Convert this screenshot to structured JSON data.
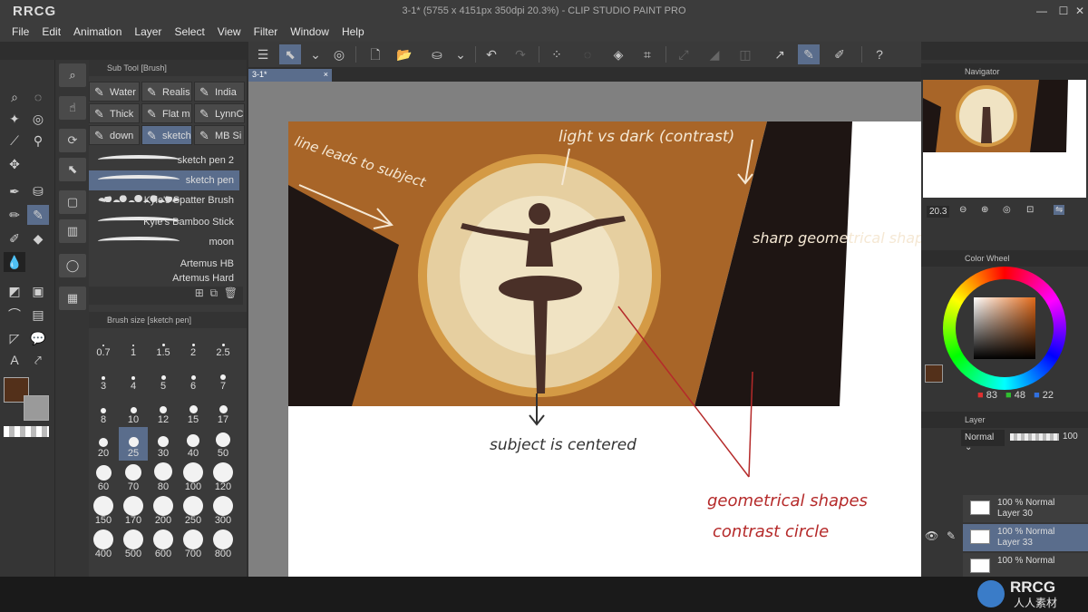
{
  "app": {
    "logo": "RRCG",
    "window_title": "3-1* (5755 x 4151px 350dpi 20.3%) - CLIP STUDIO PAINT PRO",
    "document_tab": "3-1*"
  },
  "menu": [
    "File",
    "Edit",
    "Animation",
    "Layer",
    "Select",
    "View",
    "Filter",
    "Window",
    "Help"
  ],
  "sub_tool": {
    "panel_title": "Sub Tool [Brush]",
    "tabs": [
      "Water",
      "Realis",
      "India",
      "Thick",
      "Flat m",
      "LynnC",
      "down",
      "sketch",
      "MB Si"
    ],
    "brushes": [
      "sketch pen 2",
      "sketch pen",
      "Kyle's Spatter Brush",
      "Kyle's Bamboo Stick",
      "moon",
      "Artemus HB",
      "Artemus Hard"
    ]
  },
  "brush_size": {
    "panel_title": "Brush size [sketch pen]",
    "sizes": [
      "0.7",
      "1",
      "1.5",
      "2",
      "2.5",
      "3",
      "4",
      "5",
      "6",
      "7",
      "8",
      "10",
      "12",
      "15",
      "17",
      "20",
      "25",
      "30",
      "40",
      "50",
      "60",
      "70",
      "80",
      "100",
      "120",
      "150",
      "170",
      "200",
      "250",
      "300",
      "400",
      "500",
      "600",
      "700",
      "800"
    ],
    "selected": "25"
  },
  "navigator": {
    "title": "Navigator",
    "zoom": "20.3"
  },
  "color_wheel": {
    "title": "Color Wheel",
    "r": "83",
    "g": "48",
    "b": "22",
    "current_color": "#53301a"
  },
  "layer_panel": {
    "title": "Layer",
    "blend_mode": "Normal",
    "opacity": "100",
    "layers": [
      {
        "mode": "100 % Normal",
        "name": "Layer 30"
      },
      {
        "mode": "100 % Normal",
        "name": "Layer 33"
      },
      {
        "mode": "100 % Normal",
        "name": ""
      }
    ]
  },
  "artwork": {
    "annotations": {
      "line_leads": "line leads to subject",
      "light_vs_dark": "light vs dark (contrast)",
      "sharp": "sharp geometrical shapes",
      "subject_centered": "subject is centered",
      "geo_circle_1": "geometrical shapes",
      "geo_circle_2": "contrast circle"
    },
    "colors": {
      "bg_brown": "#a86528",
      "dark": "#1e1513",
      "glow": "#f0e3c3",
      "ring": "#d49a45",
      "red_ink": "#b52a2a"
    }
  },
  "watermark": {
    "brand": "RRCG",
    "sub": "人人素材"
  }
}
